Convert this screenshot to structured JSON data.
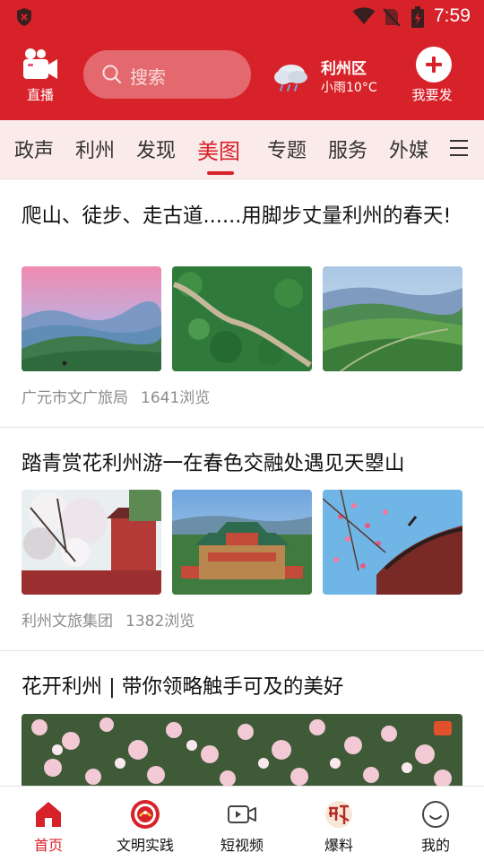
{
  "status_bar": {
    "time": "7:59"
  },
  "header": {
    "live_label": "直播",
    "search_placeholder": "搜索",
    "weather": {
      "city": "利州区",
      "condition": "小雨10°C"
    },
    "post_label": "我要发"
  },
  "tabs": {
    "items": [
      "政声",
      "利州",
      "发现",
      "美图",
      "专题",
      "服务",
      "外媒"
    ],
    "active": "美图"
  },
  "feed": [
    {
      "title": "爬山、徒步、走古道......用脚步丈量利州的春天!",
      "source": "广元市文广旅局",
      "views": "1641浏览"
    },
    {
      "title": "踏青赏花利州游一在春色交融处遇见天曌山",
      "source": "利州文旅集团",
      "views": "1382浏览"
    },
    {
      "title": "花开利州 | 带你领略触手可及的美好"
    }
  ],
  "bottom_nav": {
    "items": [
      "首页",
      "文明实践",
      "短视频",
      "爆料",
      "我的"
    ],
    "active": "首页"
  },
  "colors": {
    "brand_red": "#d8222a",
    "tab_bg": "#fbeaea",
    "meta_gray": "#8c8c8c"
  }
}
